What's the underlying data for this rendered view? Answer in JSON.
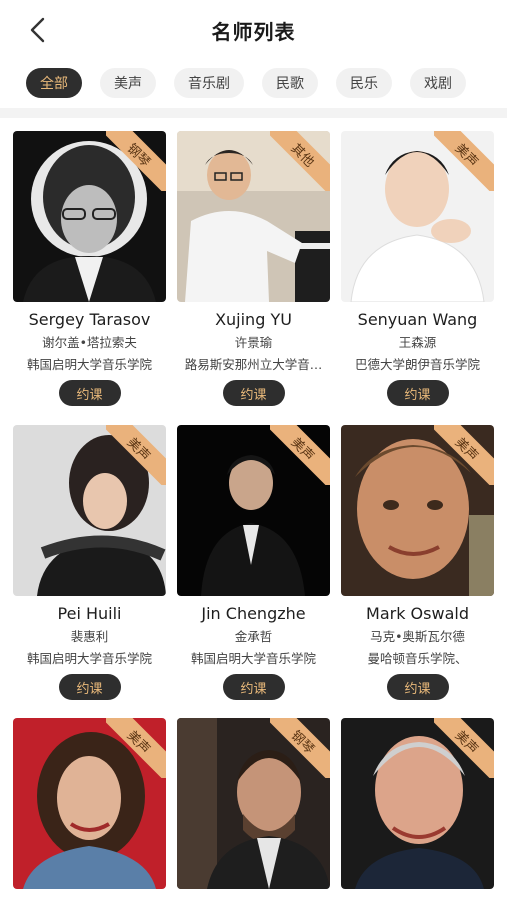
{
  "header": {
    "title": "名师列表"
  },
  "tabs": [
    "全部",
    "美声",
    "音乐剧",
    "民歌",
    "民乐",
    "戏剧"
  ],
  "book_label": "约课",
  "teachers": [
    {
      "name": "Sergey Tarasov",
      "cn_name": "谢尔盖•塔拉索夫",
      "school": "韩国启明大学音乐学院",
      "tag": "钢琴"
    },
    {
      "name": "Xujing YU",
      "cn_name": "许景瑜",
      "school": "路易斯安那州立大学音…",
      "tag": "其他"
    },
    {
      "name": "Senyuan  Wang",
      "cn_name": "王森源",
      "school": "巴德大学朗伊音乐学院",
      "tag": "美声"
    },
    {
      "name": "Pei Huili",
      "cn_name": "裴惠利",
      "school": "韩国启明大学音乐学院",
      "tag": "美声"
    },
    {
      "name": "Jin Chengzhe",
      "cn_name": "金承哲",
      "school": "韩国启明大学音乐学院",
      "tag": "美声"
    },
    {
      "name": "Mark Oswald",
      "cn_name": "马克•奥斯瓦尔德",
      "school": "曼哈顿音乐学院、",
      "tag": "美声"
    },
    {
      "name": "",
      "cn_name": "",
      "school": "",
      "tag": "美声"
    },
    {
      "name": "",
      "cn_name": "",
      "school": "",
      "tag": "钢琴"
    },
    {
      "name": "",
      "cn_name": "",
      "school": "",
      "tag": "美声"
    }
  ]
}
